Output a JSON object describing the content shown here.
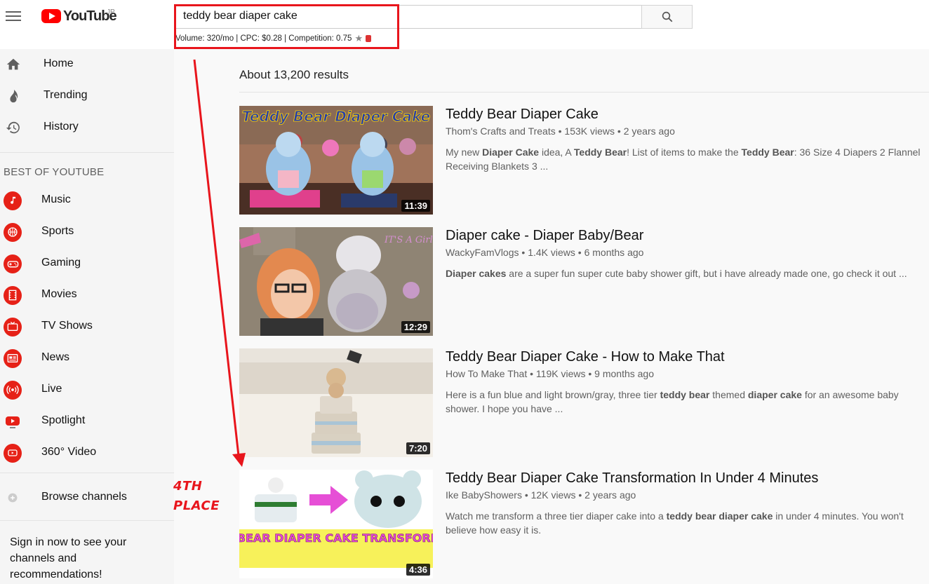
{
  "header": {
    "logo_text": "YouTube",
    "logo_region": "JP",
    "search_value": "teddy bear diaper cake",
    "seo_stats": "Volume: 320/mo | CPC: $0.28 | Competition: 0.75"
  },
  "sidebar": {
    "main_items": [
      {
        "label": "Home",
        "icon": "home-icon"
      },
      {
        "label": "Trending",
        "icon": "flame-icon"
      },
      {
        "label": "History",
        "icon": "history-icon"
      }
    ],
    "section_title": "BEST OF YOUTUBE",
    "best_items": [
      {
        "label": "Music",
        "icon": "music-icon"
      },
      {
        "label": "Sports",
        "icon": "sports-icon"
      },
      {
        "label": "Gaming",
        "icon": "gaming-icon"
      },
      {
        "label": "Movies",
        "icon": "movies-icon"
      },
      {
        "label": "TV Shows",
        "icon": "tv-icon"
      },
      {
        "label": "News",
        "icon": "news-icon"
      },
      {
        "label": "Live",
        "icon": "live-icon"
      },
      {
        "label": "Spotlight",
        "icon": "spotlight-icon"
      },
      {
        "label": "360° Video",
        "icon": "360-video-icon"
      }
    ],
    "browse_channels": "Browse channels",
    "signin_text": "Sign in now to see your channels and recommendations!"
  },
  "results_count": "About 13,200 results",
  "results": [
    {
      "title": "Teddy Bear Diaper Cake",
      "channel": "Thom's Crafts and Treats",
      "views": "153K views",
      "age": "2 years ago",
      "duration": "11:39",
      "thumb_text": "Teddy Bear Diaper Cake",
      "desc": [
        {
          "t": "My new "
        },
        {
          "t": "Diaper Cake",
          "b": true
        },
        {
          "t": " idea, A "
        },
        {
          "t": "Teddy Bear",
          "b": true
        },
        {
          "t": "! List of items to make the "
        },
        {
          "t": "Teddy Bear",
          "b": true
        },
        {
          "t": ": 36 Size 4 Diapers 2 Flannel Receiving Blankets 3 ..."
        }
      ]
    },
    {
      "title": "Diaper cake - Diaper Baby/Bear",
      "channel": "WackyFamVlogs",
      "views": "1.4K views",
      "age": "6 months ago",
      "duration": "12:29",
      "thumb_text": "IT'S A Girl!",
      "desc": [
        {
          "t": "Diaper cakes",
          "b": true
        },
        {
          "t": " are a super fun super cute baby shower gift, but i have already made one, go check it out ..."
        }
      ]
    },
    {
      "title": "Teddy Bear Diaper Cake - How to Make That",
      "channel": "How To Make That",
      "views": "119K views",
      "age": "9 months ago",
      "duration": "7:20",
      "thumb_text": "",
      "desc": [
        {
          "t": "Here is a fun blue and light brown/gray, three tier "
        },
        {
          "t": "teddy bear",
          "b": true
        },
        {
          "t": " themed "
        },
        {
          "t": "diaper cake",
          "b": true
        },
        {
          "t": " for an awesome baby shower. I hope you have ..."
        }
      ]
    },
    {
      "title": "Teddy Bear Diaper Cake Transformation In Under 4 Minutes",
      "channel": "Ike BabyShowers",
      "views": "12K views",
      "age": "2 years ago",
      "duration": "4:36",
      "thumb_text": "TEDDY BEAR DIAPER CAKE TRANSFORMATION",
      "desc": [
        {
          "t": "Watch me transform a three tier diaper cake into a "
        },
        {
          "t": "teddy bear diaper cake",
          "b": true
        },
        {
          "t": " in under 4 minutes. You won't believe how easy it is."
        }
      ]
    }
  ],
  "annotation": {
    "line1": "4TH",
    "line2": "PLACE"
  },
  "colors": {
    "accent_red": "#e8151c",
    "youtube_red": "#ff0000",
    "sidebar_bg": "#f5f5f5"
  }
}
